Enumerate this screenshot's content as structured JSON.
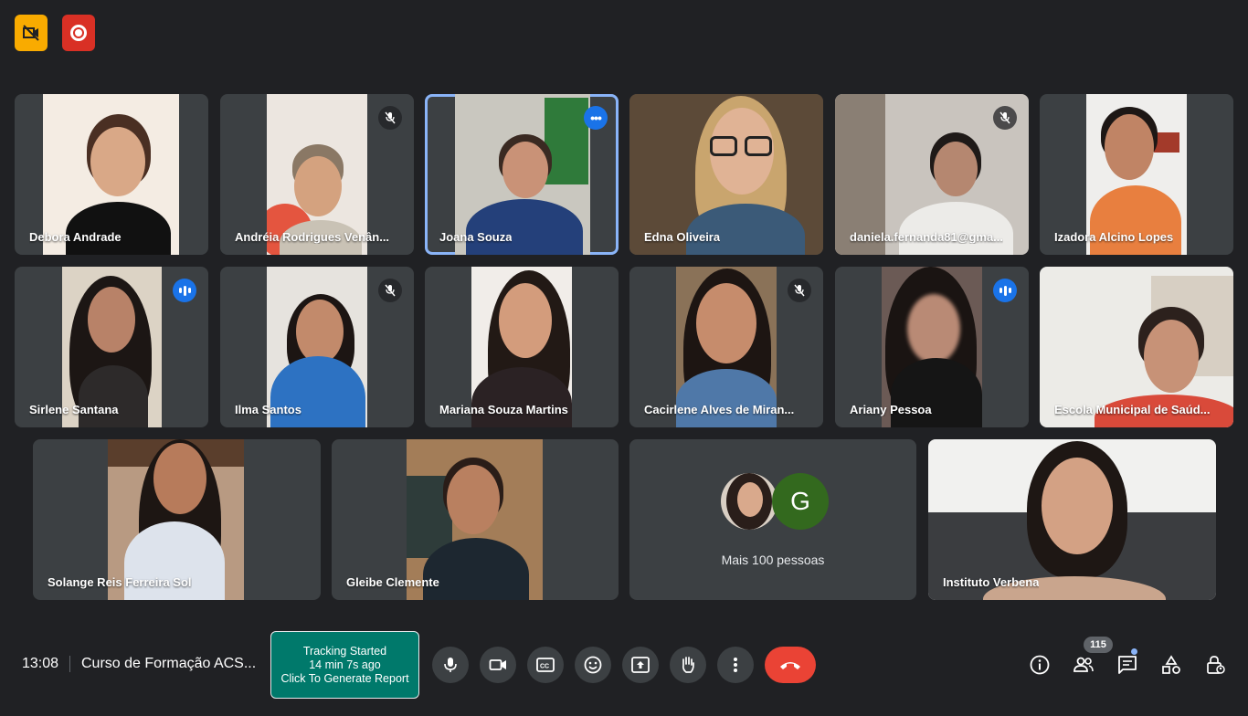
{
  "top_badges": {
    "camera_blocked": "no-camera-icon",
    "recording": "record-icon"
  },
  "tiles": [
    {
      "name": "Debora Andrade",
      "status": "none"
    },
    {
      "name": "Andréia Rodrigues Venân...",
      "status": "muted"
    },
    {
      "name": "Joana Souza",
      "status": "more"
    },
    {
      "name": "Edna Oliveira",
      "status": "none"
    },
    {
      "name": "daniela.fernanda81@gma...",
      "status": "muted"
    },
    {
      "name": "Izadora Alcino Lopes",
      "status": "none"
    },
    {
      "name": "Sirlene Santana",
      "status": "speaking"
    },
    {
      "name": "Ilma Santos",
      "status": "muted"
    },
    {
      "name": "Mariana Souza Martins",
      "status": "none"
    },
    {
      "name": "Cacirlene Alves de Miran...",
      "status": "muted"
    },
    {
      "name": "Ariany Pessoa",
      "status": "speaking"
    },
    {
      "name": "Escola Municipal de Saúd...",
      "status": "none"
    },
    {
      "name": "Solange Reis Ferreira Sol",
      "status": "none"
    },
    {
      "name": "Gleibe Clemente",
      "status": "none"
    },
    {
      "name": "Instituto Verbena",
      "status": "none"
    }
  ],
  "overflow_tile": {
    "avatar_letter": "G",
    "label": "Mais 100 pessoas"
  },
  "bottom_bar": {
    "time": "13:08",
    "meeting_title": "Curso de Formação ACS...",
    "tracking": {
      "line1": "Tracking Started",
      "line2": "14 min 7s ago",
      "line3": "Click To Generate Report"
    },
    "people_count": "115"
  },
  "colors": {
    "background": "#202124",
    "tile": "#3c4043",
    "end_call": "#ea4335",
    "tracking": "#00796b",
    "accent": "#1a73e8"
  }
}
